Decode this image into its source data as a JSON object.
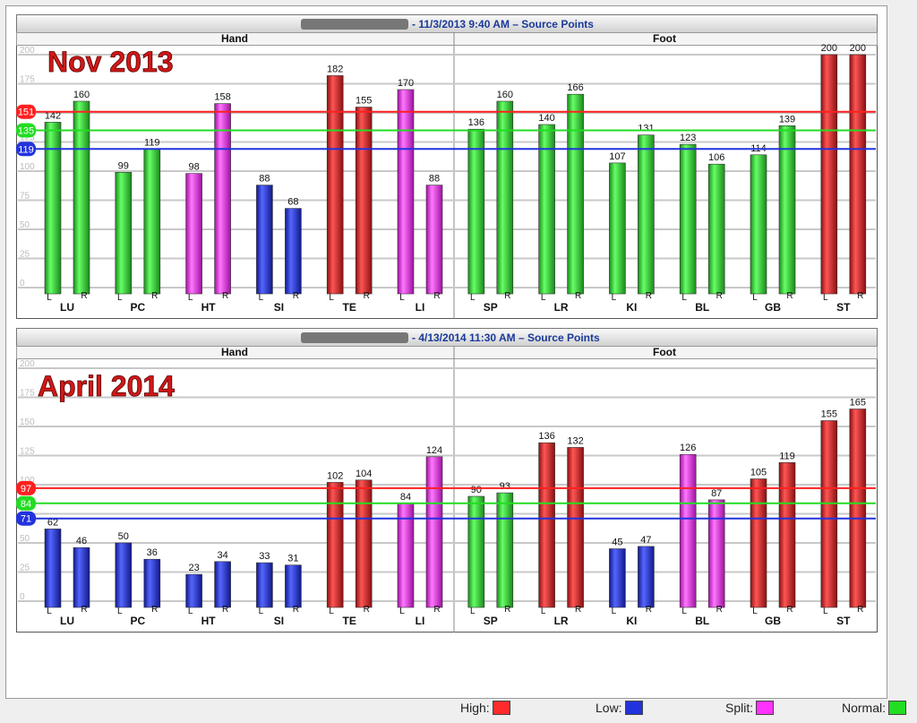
{
  "chart_data": [
    {
      "type": "bar",
      "header_date": "- 11/3/2013 9:40 AM – Source Points",
      "overlay_title": "Nov 2013",
      "sections": [
        "Hand",
        "Foot"
      ],
      "ylim": [
        0,
        200
      ],
      "yticks": [
        "0",
        "25",
        "50",
        "75",
        "100",
        "125",
        "150",
        "175",
        "200"
      ],
      "groups": [
        "LU",
        "PC",
        "HT",
        "SI",
        "TE",
        "LI",
        "SP",
        "LR",
        "KI",
        "BL",
        "GB",
        "ST"
      ],
      "side_labels": [
        "L",
        "R"
      ],
      "values": [
        142,
        160,
        99,
        119,
        98,
        158,
        88,
        68,
        182,
        155,
        170,
        88,
        136,
        160,
        140,
        166,
        107,
        131,
        123,
        106,
        114,
        139,
        200,
        200
      ],
      "categories": [
        "green",
        "green",
        "green",
        "green",
        "magenta",
        "magenta",
        "blue",
        "blue",
        "red",
        "red",
        "magenta",
        "magenta",
        "green",
        "green",
        "green",
        "green",
        "green",
        "green",
        "green",
        "green",
        "green",
        "green",
        "red",
        "red"
      ],
      "reference_lines": [
        {
          "label": "151",
          "value": 151,
          "color": "#ff2020"
        },
        {
          "label": "135",
          "value": 135,
          "color": "#22dd22"
        },
        {
          "label": "119",
          "value": 119,
          "color": "#2233dd"
        }
      ]
    },
    {
      "type": "bar",
      "header_date": "- 4/13/2014 11:30 AM – Source Points",
      "overlay_title": "April 2014",
      "sections": [
        "Hand",
        "Foot"
      ],
      "ylim": [
        0,
        200
      ],
      "yticks": [
        "0",
        "25",
        "50",
        "75",
        "100",
        "125",
        "150",
        "175",
        "200"
      ],
      "groups": [
        "LU",
        "PC",
        "HT",
        "SI",
        "TE",
        "LI",
        "SP",
        "LR",
        "KI",
        "BL",
        "GB",
        "ST"
      ],
      "side_labels": [
        "L",
        "R"
      ],
      "values": [
        62,
        46,
        50,
        36,
        23,
        34,
        33,
        31,
        102,
        104,
        84,
        124,
        90,
        93,
        136,
        132,
        45,
        47,
        126,
        87,
        105,
        119,
        155,
        165
      ],
      "categories": [
        "blue",
        "blue",
        "blue",
        "blue",
        "blue",
        "blue",
        "blue",
        "blue",
        "red",
        "red",
        "magenta",
        "magenta",
        "green",
        "green",
        "red",
        "red",
        "blue",
        "blue",
        "magenta",
        "magenta",
        "red",
        "red",
        "red",
        "red"
      ],
      "reference_lines": [
        {
          "label": "97",
          "value": 97,
          "color": "#ff2020"
        },
        {
          "label": "84",
          "value": 84,
          "color": "#22dd22"
        },
        {
          "label": "71",
          "value": 71,
          "color": "#2233dd"
        }
      ]
    }
  ],
  "legend": [
    {
      "label": "High:",
      "color": "#ff2b2b"
    },
    {
      "label": "Low:",
      "color": "#2233dd"
    },
    {
      "label": "Split:",
      "color": "#ff33ff"
    },
    {
      "label": "Normal:",
      "color": "#22dd22"
    }
  ],
  "colors": {
    "green": "#22cc22",
    "magenta": "#dd22dd",
    "blue": "#2233cc",
    "red": "#dd2222",
    "title_red": "#d01818",
    "header_blue": "#1a3a9a"
  }
}
